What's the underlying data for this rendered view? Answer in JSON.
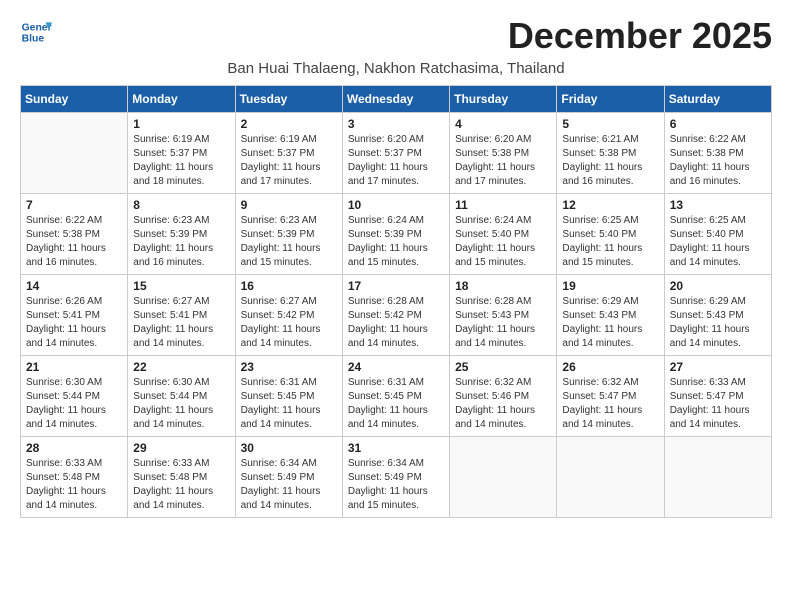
{
  "logo": {
    "line1": "General",
    "line2": "Blue"
  },
  "title": "December 2025",
  "location": "Ban Huai Thalaeng, Nakhon Ratchasima, Thailand",
  "days_header": [
    "Sunday",
    "Monday",
    "Tuesday",
    "Wednesday",
    "Thursday",
    "Friday",
    "Saturday"
  ],
  "weeks": [
    [
      {
        "day": "",
        "sunrise": "",
        "sunset": "",
        "daylight": ""
      },
      {
        "day": "1",
        "sunrise": "Sunrise: 6:19 AM",
        "sunset": "Sunset: 5:37 PM",
        "daylight": "Daylight: 11 hours and 18 minutes."
      },
      {
        "day": "2",
        "sunrise": "Sunrise: 6:19 AM",
        "sunset": "Sunset: 5:37 PM",
        "daylight": "Daylight: 11 hours and 17 minutes."
      },
      {
        "day": "3",
        "sunrise": "Sunrise: 6:20 AM",
        "sunset": "Sunset: 5:37 PM",
        "daylight": "Daylight: 11 hours and 17 minutes."
      },
      {
        "day": "4",
        "sunrise": "Sunrise: 6:20 AM",
        "sunset": "Sunset: 5:38 PM",
        "daylight": "Daylight: 11 hours and 17 minutes."
      },
      {
        "day": "5",
        "sunrise": "Sunrise: 6:21 AM",
        "sunset": "Sunset: 5:38 PM",
        "daylight": "Daylight: 11 hours and 16 minutes."
      },
      {
        "day": "6",
        "sunrise": "Sunrise: 6:22 AM",
        "sunset": "Sunset: 5:38 PM",
        "daylight": "Daylight: 11 hours and 16 minutes."
      }
    ],
    [
      {
        "day": "7",
        "sunrise": "Sunrise: 6:22 AM",
        "sunset": "Sunset: 5:38 PM",
        "daylight": "Daylight: 11 hours and 16 minutes."
      },
      {
        "day": "8",
        "sunrise": "Sunrise: 6:23 AM",
        "sunset": "Sunset: 5:39 PM",
        "daylight": "Daylight: 11 hours and 16 minutes."
      },
      {
        "day": "9",
        "sunrise": "Sunrise: 6:23 AM",
        "sunset": "Sunset: 5:39 PM",
        "daylight": "Daylight: 11 hours and 15 minutes."
      },
      {
        "day": "10",
        "sunrise": "Sunrise: 6:24 AM",
        "sunset": "Sunset: 5:39 PM",
        "daylight": "Daylight: 11 hours and 15 minutes."
      },
      {
        "day": "11",
        "sunrise": "Sunrise: 6:24 AM",
        "sunset": "Sunset: 5:40 PM",
        "daylight": "Daylight: 11 hours and 15 minutes."
      },
      {
        "day": "12",
        "sunrise": "Sunrise: 6:25 AM",
        "sunset": "Sunset: 5:40 PM",
        "daylight": "Daylight: 11 hours and 15 minutes."
      },
      {
        "day": "13",
        "sunrise": "Sunrise: 6:25 AM",
        "sunset": "Sunset: 5:40 PM",
        "daylight": "Daylight: 11 hours and 14 minutes."
      }
    ],
    [
      {
        "day": "14",
        "sunrise": "Sunrise: 6:26 AM",
        "sunset": "Sunset: 5:41 PM",
        "daylight": "Daylight: 11 hours and 14 minutes."
      },
      {
        "day": "15",
        "sunrise": "Sunrise: 6:27 AM",
        "sunset": "Sunset: 5:41 PM",
        "daylight": "Daylight: 11 hours and 14 minutes."
      },
      {
        "day": "16",
        "sunrise": "Sunrise: 6:27 AM",
        "sunset": "Sunset: 5:42 PM",
        "daylight": "Daylight: 11 hours and 14 minutes."
      },
      {
        "day": "17",
        "sunrise": "Sunrise: 6:28 AM",
        "sunset": "Sunset: 5:42 PM",
        "daylight": "Daylight: 11 hours and 14 minutes."
      },
      {
        "day": "18",
        "sunrise": "Sunrise: 6:28 AM",
        "sunset": "Sunset: 5:43 PM",
        "daylight": "Daylight: 11 hours and 14 minutes."
      },
      {
        "day": "19",
        "sunrise": "Sunrise: 6:29 AM",
        "sunset": "Sunset: 5:43 PM",
        "daylight": "Daylight: 11 hours and 14 minutes."
      },
      {
        "day": "20",
        "sunrise": "Sunrise: 6:29 AM",
        "sunset": "Sunset: 5:43 PM",
        "daylight": "Daylight: 11 hours and 14 minutes."
      }
    ],
    [
      {
        "day": "21",
        "sunrise": "Sunrise: 6:30 AM",
        "sunset": "Sunset: 5:44 PM",
        "daylight": "Daylight: 11 hours and 14 minutes."
      },
      {
        "day": "22",
        "sunrise": "Sunrise: 6:30 AM",
        "sunset": "Sunset: 5:44 PM",
        "daylight": "Daylight: 11 hours and 14 minutes."
      },
      {
        "day": "23",
        "sunrise": "Sunrise: 6:31 AM",
        "sunset": "Sunset: 5:45 PM",
        "daylight": "Daylight: 11 hours and 14 minutes."
      },
      {
        "day": "24",
        "sunrise": "Sunrise: 6:31 AM",
        "sunset": "Sunset: 5:45 PM",
        "daylight": "Daylight: 11 hours and 14 minutes."
      },
      {
        "day": "25",
        "sunrise": "Sunrise: 6:32 AM",
        "sunset": "Sunset: 5:46 PM",
        "daylight": "Daylight: 11 hours and 14 minutes."
      },
      {
        "day": "26",
        "sunrise": "Sunrise: 6:32 AM",
        "sunset": "Sunset: 5:47 PM",
        "daylight": "Daylight: 11 hours and 14 minutes."
      },
      {
        "day": "27",
        "sunrise": "Sunrise: 6:33 AM",
        "sunset": "Sunset: 5:47 PM",
        "daylight": "Daylight: 11 hours and 14 minutes."
      }
    ],
    [
      {
        "day": "28",
        "sunrise": "Sunrise: 6:33 AM",
        "sunset": "Sunset: 5:48 PM",
        "daylight": "Daylight: 11 hours and 14 minutes."
      },
      {
        "day": "29",
        "sunrise": "Sunrise: 6:33 AM",
        "sunset": "Sunset: 5:48 PM",
        "daylight": "Daylight: 11 hours and 14 minutes."
      },
      {
        "day": "30",
        "sunrise": "Sunrise: 6:34 AM",
        "sunset": "Sunset: 5:49 PM",
        "daylight": "Daylight: 11 hours and 14 minutes."
      },
      {
        "day": "31",
        "sunrise": "Sunrise: 6:34 AM",
        "sunset": "Sunset: 5:49 PM",
        "daylight": "Daylight: 11 hours and 15 minutes."
      },
      {
        "day": "",
        "sunrise": "",
        "sunset": "",
        "daylight": ""
      },
      {
        "day": "",
        "sunrise": "",
        "sunset": "",
        "daylight": ""
      },
      {
        "day": "",
        "sunrise": "",
        "sunset": "",
        "daylight": ""
      }
    ]
  ]
}
